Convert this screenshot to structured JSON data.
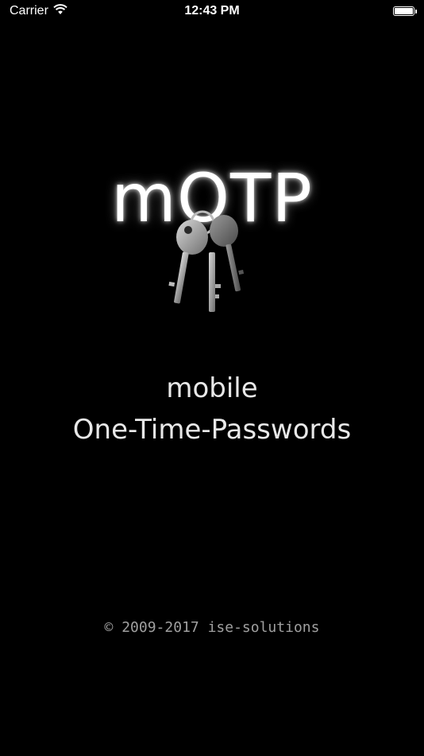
{
  "status_bar": {
    "carrier": "Carrier",
    "time": "12:43 PM",
    "battery_level": 1.0
  },
  "splash": {
    "logo_text": "mOTP",
    "tagline_line1": "mobile",
    "tagline_line2": "One-Time-Passwords",
    "copyright": "© 2009-2017 ise-solutions"
  },
  "icons": {
    "wifi": "wifi-icon",
    "battery": "battery-icon",
    "keys": "keys-icon"
  }
}
